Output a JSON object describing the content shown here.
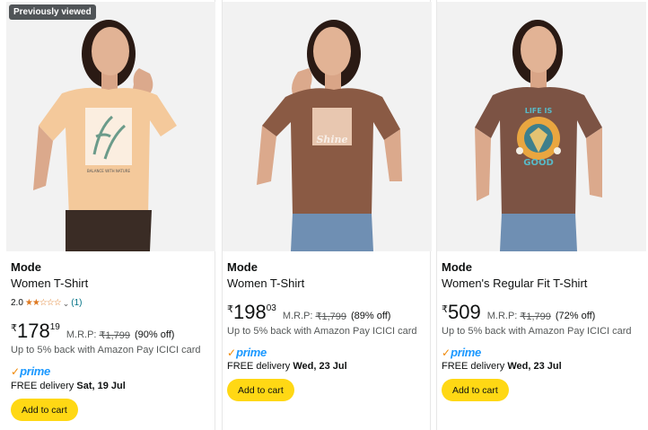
{
  "products": [
    {
      "badge": "Previously viewed",
      "brand": "Mode",
      "title": "Women T-Shirt",
      "rating": "2.0",
      "stars": "★★☆☆☆",
      "review_count": "(1)",
      "currency": "₹",
      "price_whole": "178",
      "price_fraction": "19",
      "mrp_label": "M.R.P:",
      "mrp": "₹1,799",
      "discount": "(90% off)",
      "cashback": "Up to 5% back with Amazon Pay ICICI card",
      "prime_label": "prime",
      "delivery_prefix": "FREE delivery ",
      "delivery_date": "Sat, 19 Jul",
      "button": "Add to cart",
      "shirt_color": "#f4c99b",
      "print_text": "BALANCE WITH NATURE"
    },
    {
      "brand": "Mode",
      "title": "Women T-Shirt",
      "currency": "₹",
      "price_whole": "198",
      "price_fraction": "03",
      "mrp_label": "M.R.P:",
      "mrp": "₹1,799",
      "discount": "(89% off)",
      "cashback": "Up to 5% back with Amazon Pay ICICI card",
      "prime_label": "prime",
      "delivery_prefix": "FREE delivery ",
      "delivery_date": "Wed, 23 Jul",
      "button": "Add to cart",
      "shirt_color": "#8a5a44",
      "print_text": "Shine"
    },
    {
      "brand": "Mode",
      "title": "Women's Regular Fit T-Shirt",
      "currency": "₹",
      "price_whole": "509",
      "price_fraction": "",
      "mrp_label": "M.R.P:",
      "mrp": "₹1,799",
      "discount": "(72% off)",
      "cashback": "Up to 5% back with Amazon Pay ICICI card",
      "prime_label": "prime",
      "delivery_prefix": "FREE delivery ",
      "delivery_date": "Wed, 23 Jul",
      "button": "Add to cart",
      "shirt_color": "#7c5344",
      "print_text_top": "LIFE IS",
      "print_text_bottom": "GOOD"
    }
  ],
  "colors": {
    "button_yellow": "#ffd814",
    "star_orange": "#de7921",
    "prime_blue": "#1a98ff",
    "link_teal": "#007185",
    "badge_gray": "#505457"
  }
}
